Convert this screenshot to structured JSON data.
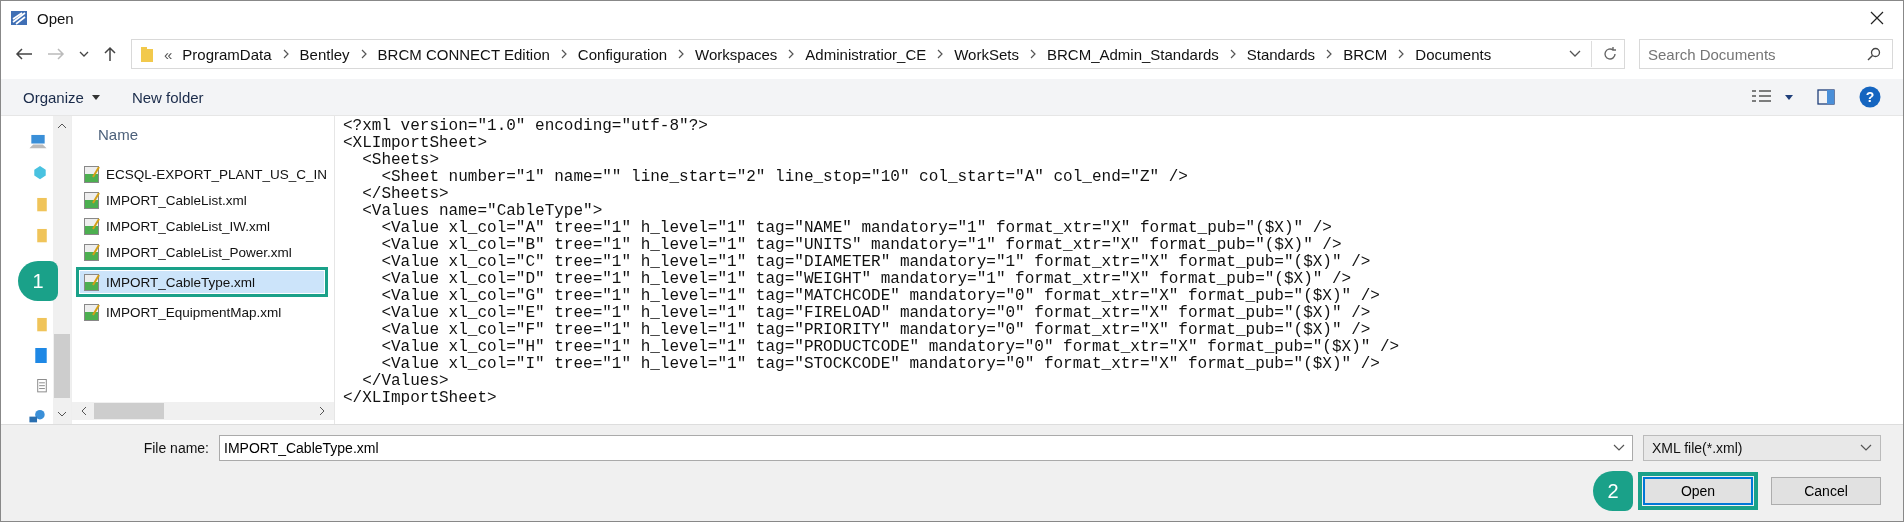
{
  "window": {
    "title": "Open"
  },
  "address_bar": {
    "overflow": "«",
    "path": [
      "ProgramData",
      "Bentley",
      "BRCM CONNECT Edition",
      "Configuration",
      "Workspaces",
      "Administratior_CE",
      "WorkSets",
      "BRCM_Admin_Standards",
      "Standards",
      "BRCM",
      "Documents"
    ]
  },
  "search": {
    "placeholder": "Search Documents"
  },
  "toolbar": {
    "organize": "Organize",
    "new_folder": "New folder",
    "help": "?"
  },
  "file_list": {
    "column": "Name",
    "files": [
      {
        "name": "ECSQL-EXPORT_PLANT_US_C_IN",
        "selected": false
      },
      {
        "name": "IMPORT_CableList.xml",
        "selected": false
      },
      {
        "name": "IMPORT_CableList_IW.xml",
        "selected": false
      },
      {
        "name": "IMPORT_CableList_Power.xml",
        "selected": false
      },
      {
        "name": "IMPORT_CableType.xml",
        "selected": true,
        "callout": "1"
      },
      {
        "name": "IMPORT_EquipmentMap.xml",
        "selected": false
      }
    ]
  },
  "preview": {
    "lines": [
      "<?xml version=\"1.0\" encoding=\"utf-8\"?>",
      "<XLImportSheet>",
      "  <Sheets>",
      "    <Sheet number=\"1\" name=\"\" line_start=\"2\" line_stop=\"10\" col_start=\"A\" col_end=\"Z\" />",
      "  </Sheets>",
      "  <Values name=\"CableType\">",
      "    <Value xl_col=\"A\" tree=\"1\" h_level=\"1\" tag=\"NAME\" mandatory=\"1\" format_xtr=\"X\" format_pub=\"($X)\" />",
      "    <Value xl_col=\"B\" tree=\"1\" h_level=\"1\" tag=\"UNITS\" mandatory=\"1\" format_xtr=\"X\" format_pub=\"($X)\" />",
      "    <Value xl_col=\"C\" tree=\"1\" h_level=\"1\" tag=\"DIAMETER\" mandatory=\"1\" format_xtr=\"X\" format_pub=\"($X)\" />",
      "    <Value xl_col=\"D\" tree=\"1\" h_level=\"1\" tag=\"WEIGHT\" mandatory=\"1\" format_xtr=\"X\" format_pub=\"($X)\" />",
      "    <Value xl_col=\"G\" tree=\"1\" h_level=\"1\" tag=\"MATCHCODE\" mandatory=\"0\" format_xtr=\"X\" format_pub=\"($X)\" />",
      "    <Value xl_col=\"E\" tree=\"1\" h_level=\"1\" tag=\"FIRELOAD\" mandatory=\"0\" format_xtr=\"X\" format_pub=\"($X)\" />",
      "    <Value xl_col=\"F\" tree=\"1\" h_level=\"1\" tag=\"PRIORITY\" mandatory=\"0\" format_xtr=\"X\" format_pub=\"($X)\" />",
      "    <Value xl_col=\"H\" tree=\"1\" h_level=\"1\" tag=\"PRODUCTCODE\" mandatory=\"0\" format_xtr=\"X\" format_pub=\"($X)\" />",
      "    <Value xl_col=\"I\" tree=\"1\" h_level=\"1\" tag=\"STOCKCODE\" mandatory=\"0\" format_xtr=\"X\" format_pub=\"($X)\" />",
      "  </Values>",
      "</XLImportSheet>"
    ]
  },
  "file_name": {
    "label": "File name:",
    "value": "IMPORT_CableType.xml"
  },
  "file_type": {
    "value": "XML file(*.xml)"
  },
  "buttons": [
    {
      "kind": "open",
      "label": "Open",
      "callout": "2"
    },
    {
      "kind": "cancel",
      "label": "Cancel"
    }
  ]
}
